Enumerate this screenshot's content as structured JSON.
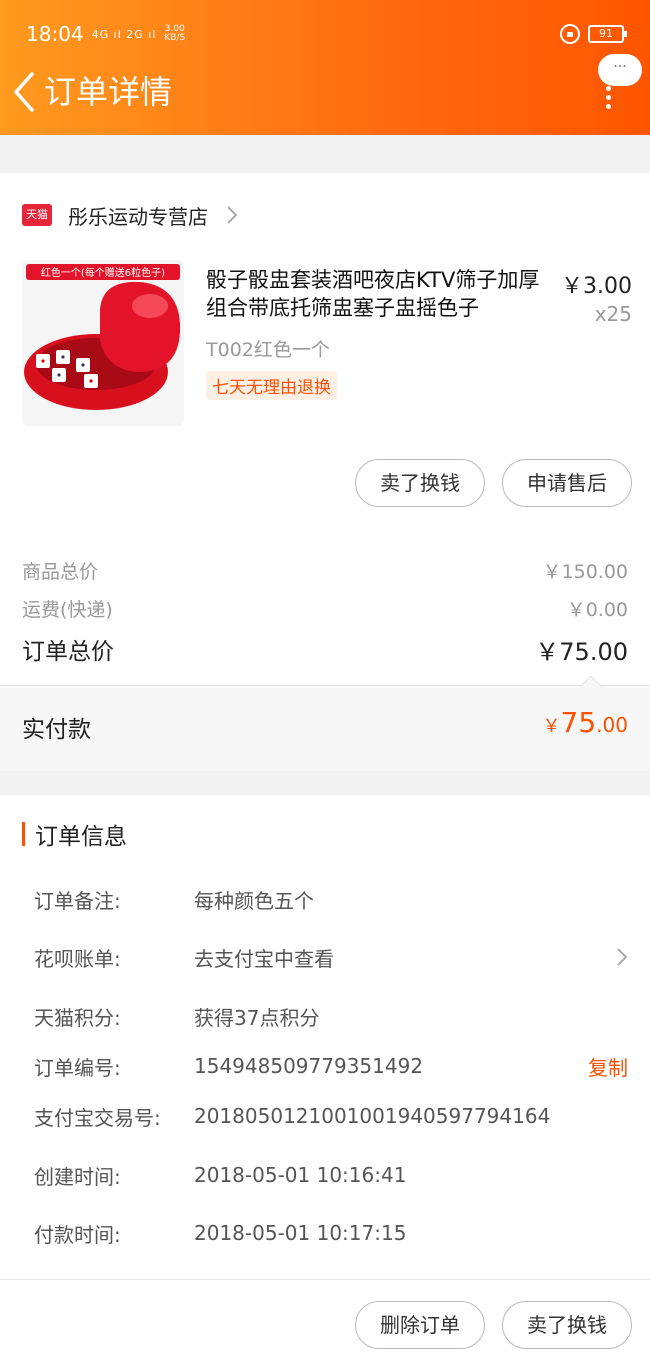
{
  "status_bar": {
    "time": "18:04",
    "network": "4G ıl 2G ıl",
    "speed_value": "3.00",
    "speed_unit": "KB/S",
    "battery": "91"
  },
  "nav": {
    "title": "订单详情",
    "more_label": "···"
  },
  "shop": {
    "badge": "天猫",
    "name": "彤乐运动专营店"
  },
  "product": {
    "image_caption": "红色一个(每个赠送6粒色子)",
    "title": "骰子骰盅套装酒吧夜店KTV筛子加厚组合带底托筛盅塞子盅摇色子",
    "price": "￥3.00",
    "quantity": "x25",
    "spec": "T002红色一个",
    "badge": "七天无理由退换"
  },
  "actions": {
    "sell_label": "卖了换钱",
    "aftersale_label": "申请售后"
  },
  "summary": {
    "goods_total_label": "商品总价",
    "goods_total_value": "￥150.00",
    "shipping_label": "运费(快递)",
    "shipping_value": "￥0.00",
    "order_total_label": "订单总价",
    "order_total_value": "￥75.00",
    "paid_label": "实付款",
    "paid_symbol": "￥",
    "paid_integer": "75",
    "paid_decimal": ".00"
  },
  "order_info": {
    "title": "订单信息",
    "rows": [
      {
        "label": "订单备注:",
        "value": "每种颜色五个"
      },
      {
        "label": "花呗账单:",
        "value": "去支付宝中查看"
      },
      {
        "label": "天猫积分:",
        "value": "获得37点积分"
      },
      {
        "label": "订单编号:",
        "value": "154948509779351492",
        "action": "复制"
      },
      {
        "label": "支付宝交易号:",
        "value": "2018050121001001940597794164"
      },
      {
        "label": "创建时间:",
        "value": "2018-05-01 10:16:41"
      },
      {
        "label": "付款时间:",
        "value": "2018-05-01 10:17:15"
      }
    ]
  },
  "bottom": {
    "delete_label": "删除订单",
    "sell_label": "卖了换钱"
  },
  "colors": {
    "accent": "#ff5000",
    "header_start": "#ff9a1e",
    "header_end": "#ff5500"
  }
}
